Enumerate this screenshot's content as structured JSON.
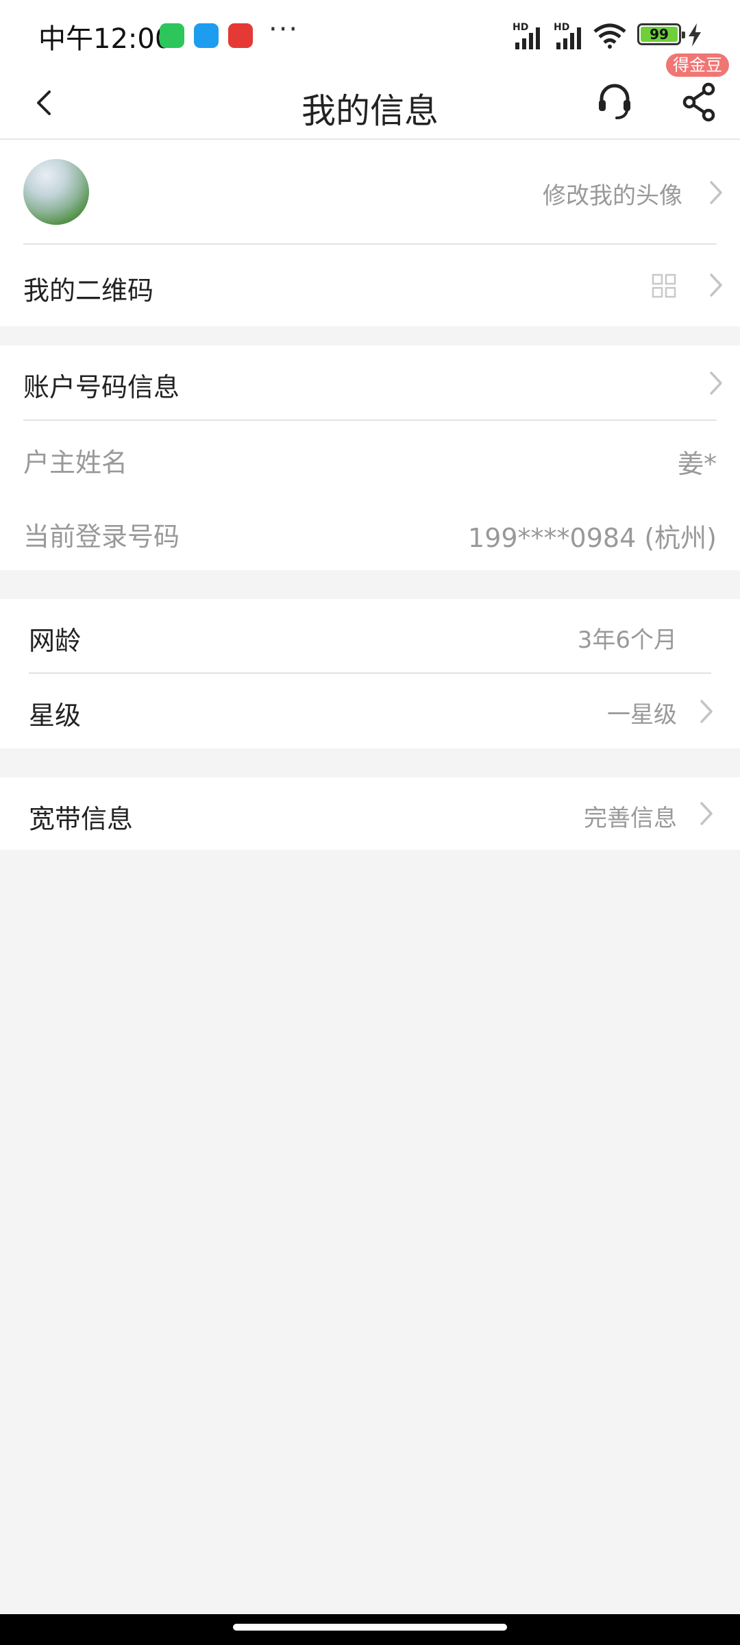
{
  "status_bar": {
    "time": "中午12:00",
    "dots": "···",
    "hd1": "HD",
    "hd2": "HD",
    "battery": "99"
  },
  "header": {
    "title": "我的信息",
    "badge": "得金豆"
  },
  "profile": {
    "avatar_action": "修改我的头像",
    "qr_label": "我的二维码"
  },
  "account": {
    "section_label": "账户号码信息",
    "owner_label": "户主姓名",
    "owner_value": "姜*",
    "login_label": "当前登录号码",
    "login_value": "199****0984 (杭州)"
  },
  "member": {
    "age_label": "网龄",
    "age_value": "3年6个月",
    "star_label": "星级",
    "star_value": "一星级"
  },
  "broadband": {
    "label": "宽带信息",
    "action": "完善信息"
  },
  "colors": {
    "badge": "#f07573",
    "background": "#f4f4f4",
    "battery_fill": "#6fcf3a"
  }
}
